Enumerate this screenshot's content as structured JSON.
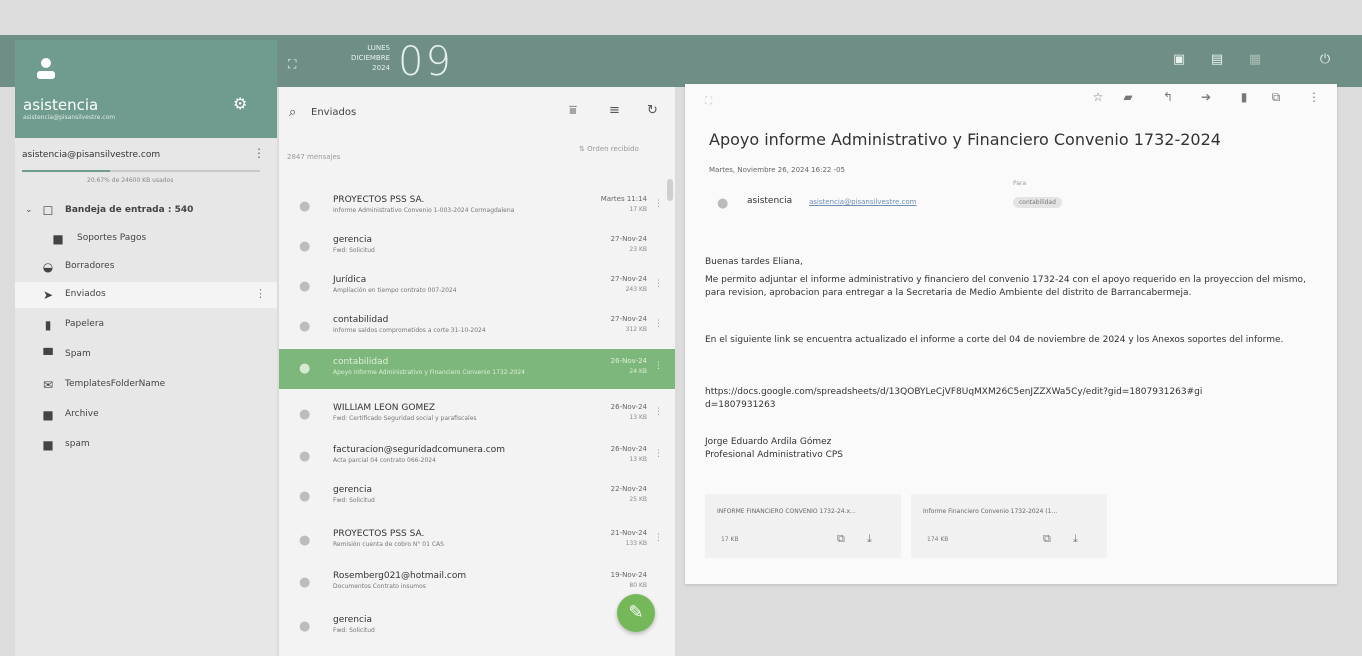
{
  "topbar": {
    "fullscreen_icon": "expand-icon",
    "day_name": "LUNES",
    "month": "DICIEMBRE",
    "year": "2024",
    "day_number": "09",
    "icons": [
      "calendar-icon",
      "contacts-icon",
      "grid-icon",
      "power-icon"
    ]
  },
  "sidebar": {
    "user_name": "asistencia",
    "user_email": "asistencia@pisansilvestre.com",
    "account": "asistencia@pisansilvestre.com",
    "quota_text": "20.67% de 24600 KB usados",
    "quota_fraction": 0.21,
    "folders": [
      {
        "label": "Bandeja de entrada",
        "badge": "540",
        "icon": "inbox-icon"
      },
      {
        "label": "Soportes Pagos",
        "icon": "folder-icon"
      },
      {
        "label": "Borradores",
        "icon": "drafts-icon"
      },
      {
        "label": "Enviados",
        "icon": "sent-icon"
      },
      {
        "label": "Papelera",
        "icon": "trash-icon"
      },
      {
        "label": "Spam",
        "icon": "spam-icon"
      },
      {
        "label": "TemplatesFolderName",
        "icon": "template-icon"
      },
      {
        "label": "Archive",
        "icon": "folder-icon"
      },
      {
        "label": "spam",
        "icon": "folder-icon"
      }
    ]
  },
  "list": {
    "search_text": "Enviados",
    "count_text": "2847 mensajes",
    "order_text": "Orden recibido",
    "messages": [
      {
        "from": "PROYECTOS PSS SA.",
        "subject": "Informe Administrativo Convenio 1-003-2024 Cormagdalena",
        "date": "Martes 11:14",
        "size": "17 KB"
      },
      {
        "from": "gerencia",
        "subject": "Fwd: Solicitud",
        "date": "27-Nov-24",
        "size": "23 KB"
      },
      {
        "from": "Jurídica",
        "subject": "Ampliación en tiempo contrato 007-2024",
        "date": "27-Nov-24",
        "size": "243 KB"
      },
      {
        "from": "contabilidad",
        "subject": "Informe saldos comprometidos a corte 31-10-2024",
        "date": "27-Nov-24",
        "size": "312 KB"
      },
      {
        "from": "contabilidad",
        "subject": "Apoyo informe Administrativo y Financiero Convenio 1732-2024",
        "date": "26-Nov-24",
        "size": "24 KB"
      },
      {
        "from": "WILLIAM LEON GOMEZ",
        "subject": "Fwd: Certificado Seguridad social y parafiscales",
        "date": "26-Nov-24",
        "size": "13 KB"
      },
      {
        "from": "facturacion@seguridadcomunera.com",
        "subject": "Acta parcial 04 contrato 066-2024",
        "date": "26-Nov-24",
        "size": "13 KB"
      },
      {
        "from": "gerencia",
        "subject": "Fwd: Solicitud",
        "date": "22-Nov-24",
        "size": "25 KB"
      },
      {
        "from": "PROYECTOS PSS SA.",
        "subject": "Remisión cuenta de cobro N° 01 CAS",
        "date": "21-Nov-24",
        "size": "133 KB"
      },
      {
        "from": "Rosemberg021@hotmail.com",
        "subject": "Documentos Contrato insumos",
        "date": "19-Nov-24",
        "size": "80 KB"
      },
      {
        "from": "gerencia",
        "subject": "Fwd: Solicitud",
        "date": "",
        "size": ""
      }
    ]
  },
  "reader": {
    "title": "Apoyo informe Administrativo y Financiero Convenio 1732-2024",
    "date": "Martes, Noviembre 26, 2024 16:22 -05",
    "sender_name": "asistencia",
    "sender_email": "asistencia@pisansilvestre.com",
    "para_label": "Para",
    "recipient_chip": "contabilidad",
    "greeting": "Buenas tardes Eliana,",
    "p1": "Me permito adjuntar el informe administrativo y financiero del convenio 1732-24 con el apoyo requerido en la proyeccion del mismo, para revision, aprobacion para entregar a la Secretaria de Medio Ambiente del distrito de Barrancabermeja.",
    "p2": "En el siguiente link se encuentra actualizado el informe a corte del 04 de noviembre de 2024 y los Anexos soportes del informe.",
    "link": "https://docs.google.com/spreadsheets/d/13QOBYLeCjVF8UqMXM26C5enJZZXWa5Cy/edit?gid=1807931263#gid=1807931263",
    "sign_name": "Jorge Eduardo Ardila Gómez",
    "sign_role": "Profesional Administrativo CPS",
    "attachments": [
      {
        "name": "INFORME FINANCIERO CONVENIO 1732-24.x...",
        "size": "17 KB"
      },
      {
        "name": "Informe Financiero Convenio 1732-2024 (1...",
        "size": "174 KB"
      }
    ]
  }
}
